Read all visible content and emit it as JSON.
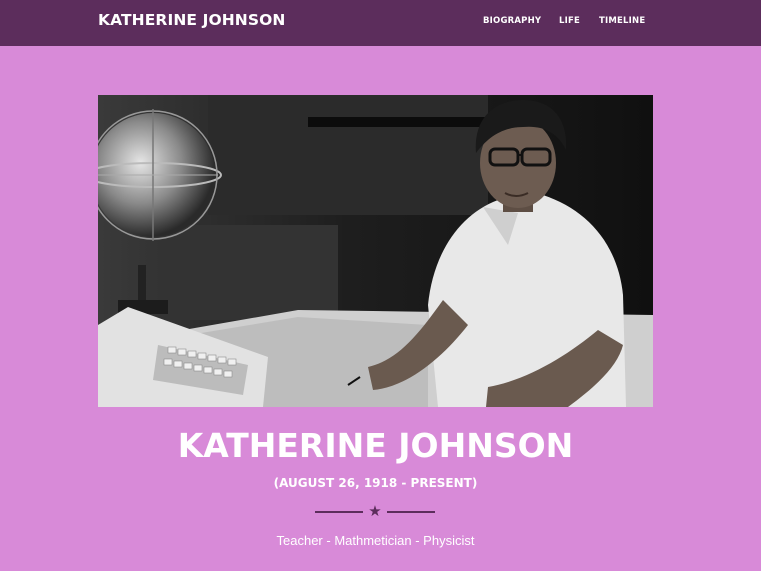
{
  "navbar": {
    "brand": "KATHERINE JOHNSON",
    "links": [
      "BIOGRAPHY",
      "LIFE",
      "TIMELINE"
    ],
    "background_color": "#5c2d5c"
  },
  "hero": {
    "photo_subject": "black-and-white photograph of Katherine Johnson at a desk with a calculating machine and a celestial globe",
    "name": "KATHERINE JOHNSON",
    "dates": "(AUGUST 26, 1918 - PRESENT)",
    "divider_icon": "star-icon",
    "roles": "Teacher - Mathmetician - Physicist"
  },
  "colors": {
    "page_background": "#d88ad8",
    "accent": "#5c2d5c",
    "text": "#ffffff"
  }
}
